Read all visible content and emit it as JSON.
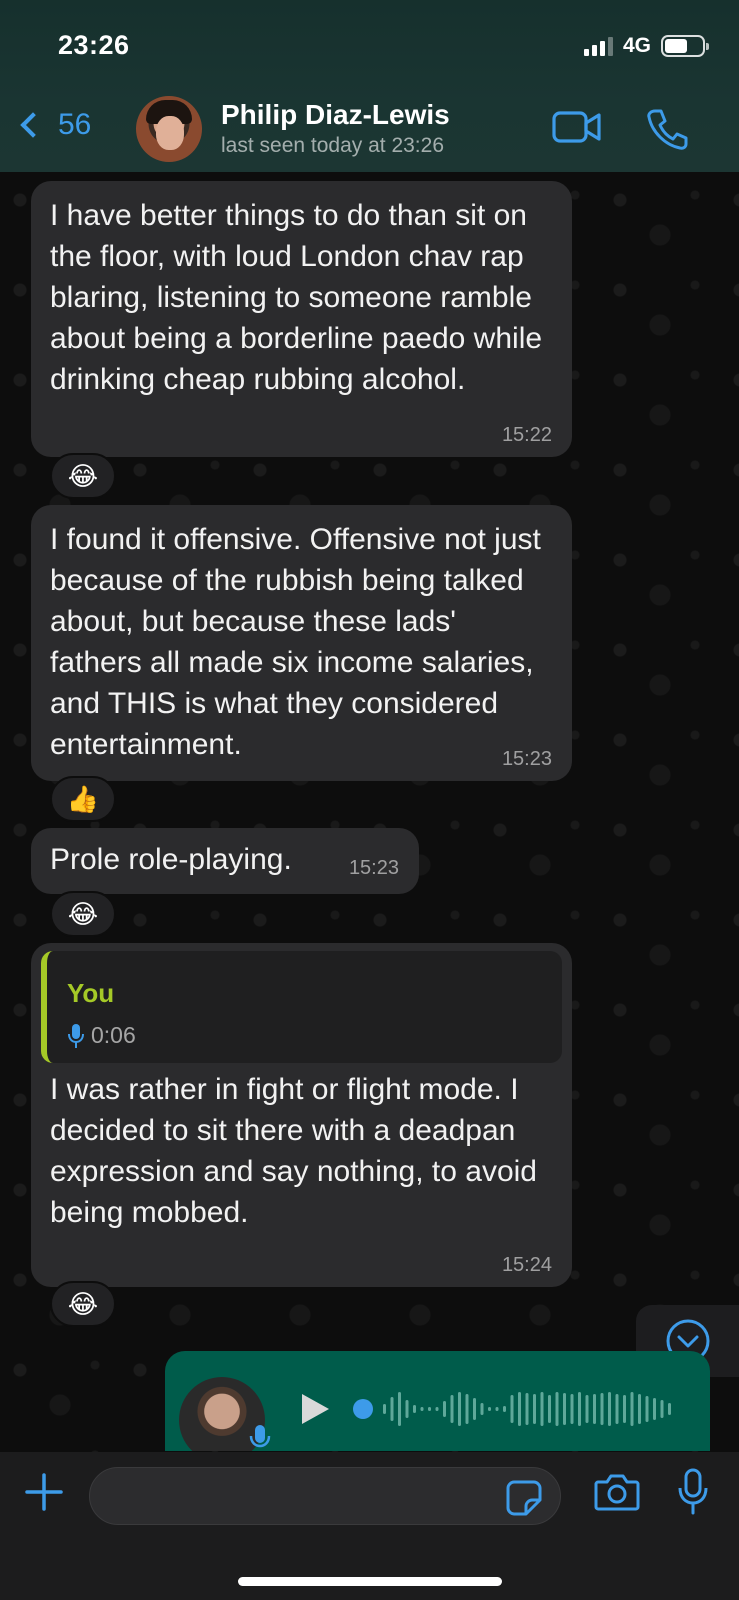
{
  "status_bar": {
    "time": "23:26",
    "network": "4G"
  },
  "header": {
    "back_count": "56",
    "contact_name": "Philip Diaz-Lewis",
    "contact_status": "last seen today at 23:26"
  },
  "messages": [
    {
      "text": "I have better things to do than sit on the floor, with loud London chav rap blaring, listening to someone ramble about being a borderline paedo while drinking cheap rubbing alcohol.",
      "time": "15:22",
      "reaction": "😂"
    },
    {
      "text": "I found it offensive. Offensive not just because of the rubbish being talked about, but because these lads' fathers all made six income salaries, and THIS is what they considered entertainment.",
      "time": "15:23",
      "reaction": "👍"
    },
    {
      "text": "Prole role-playing.",
      "time": "15:23",
      "reaction": "😂"
    },
    {
      "quote": {
        "author": "You",
        "duration": "0:06"
      },
      "text": "I was rather in fight or flight mode. I decided to sit there with a deadpan expression and say nothing, to avoid being mobbed.",
      "time": "15:24",
      "reaction": "😂"
    }
  ],
  "icons": {
    "video": "video-camera-icon",
    "call": "phone-icon",
    "attach": "plus-icon",
    "sticker": "sticker-icon",
    "camera": "camera-icon",
    "mic": "microphone-icon",
    "scroll": "chevron-down-circle-icon",
    "play": "play-icon"
  },
  "colors": {
    "accent": "#3d9be9",
    "outgoing_bubble": "#005c4b",
    "incoming_bubble": "#2b2b2d",
    "quote_bar": "#a5c927"
  }
}
